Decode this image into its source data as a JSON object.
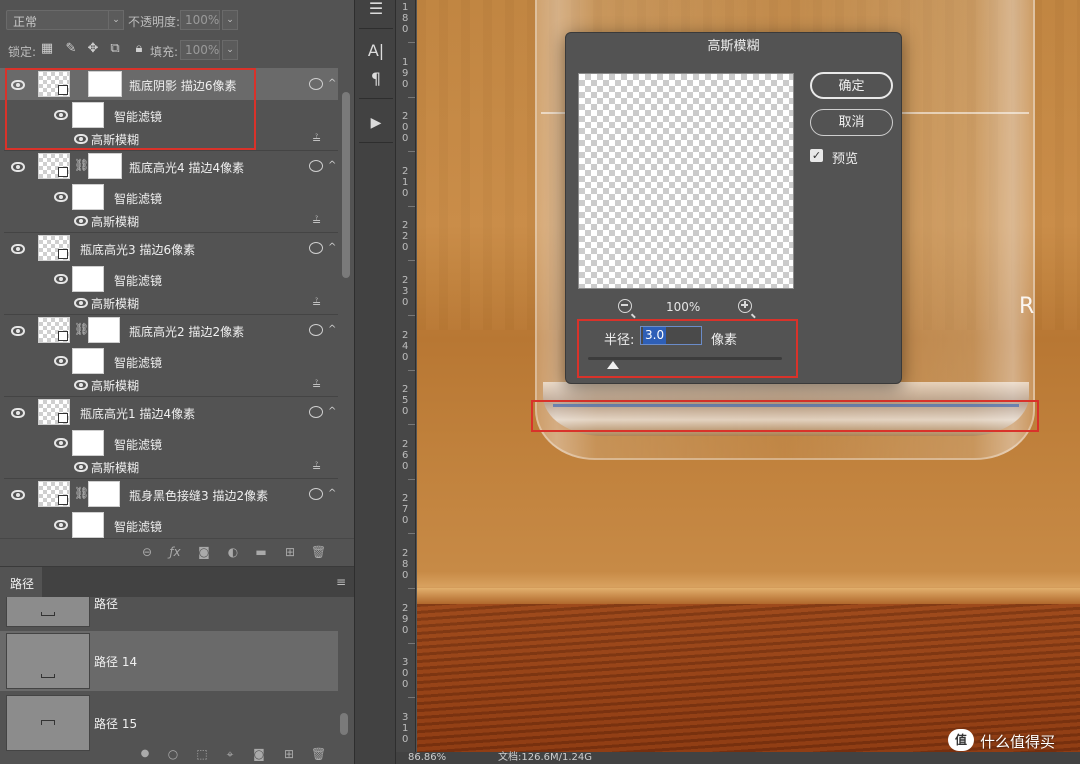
{
  "options": {
    "blend_mode": "正常",
    "opacity_label": "不透明度:",
    "opacity_value": "100%",
    "lock_label": "锁定:",
    "fill_label": "填充:",
    "fill_value": "100%"
  },
  "layers": [
    {
      "name": "瓶底阴影 描边6像素",
      "filter_group": "智能滤镜",
      "filter": "高斯模糊",
      "selected": true
    },
    {
      "name": "瓶底高光4 描边4像素",
      "filter_group": "智能滤镜",
      "filter": "高斯模糊"
    },
    {
      "name": "瓶底高光3 描边6像素",
      "filter_group": "智能滤镜",
      "filter": "高斯模糊"
    },
    {
      "name": "瓶底高光2 描边2像素",
      "filter_group": "智能滤镜",
      "filter": "高斯模糊"
    },
    {
      "name": "瓶底高光1 描边4像素",
      "filter_group": "智能滤镜",
      "filter": "高斯模糊"
    },
    {
      "name": "瓶身黑色接缝3 描边2像素",
      "filter_group": "智能滤镜"
    }
  ],
  "layers_footer_icons": [
    "link-icon",
    "fx-icon",
    "mask-icon",
    "adjustment-icon",
    "folder-icon",
    "new-layer-icon",
    "trash-icon"
  ],
  "paths_panel": {
    "tab": "路径",
    "partial_label": "路径",
    "items": [
      {
        "name": "路径 14",
        "selected": true
      },
      {
        "name": "路径 15"
      }
    ]
  },
  "paths_footer_icons": [
    "fill-path-icon",
    "stroke-path-icon",
    "load-selection-icon",
    "work-path-icon",
    "path-mask-icon",
    "new-path-icon",
    "trash-icon"
  ],
  "tools": [
    "adjust-icon",
    "character-icon",
    "paragraph-icon",
    "play-icon"
  ],
  "tool_glyphs": {
    "character": "A|",
    "paragraph": "¶",
    "play": "▶"
  },
  "ruler_labels": [
    "180",
    "190",
    "200",
    "210",
    "220",
    "230",
    "240",
    "250",
    "260",
    "270",
    "280",
    "290",
    "300",
    "310"
  ],
  "canvas": {
    "glass_letter": "R"
  },
  "dialog": {
    "title": "高斯模糊",
    "zoom": "100%",
    "ok": "确定",
    "cancel": "取消",
    "preview_label": "预览",
    "preview_checked": true,
    "radius_label": "半径:",
    "radius_value": "3.0",
    "radius_unit": "像素",
    "radius_slider_fraction": 0.015
  },
  "status": {
    "zoom": "86.86%",
    "doc": "文档:126.6M/1.24G"
  },
  "watermark": {
    "badge": "值",
    "text": "什么值得买"
  }
}
